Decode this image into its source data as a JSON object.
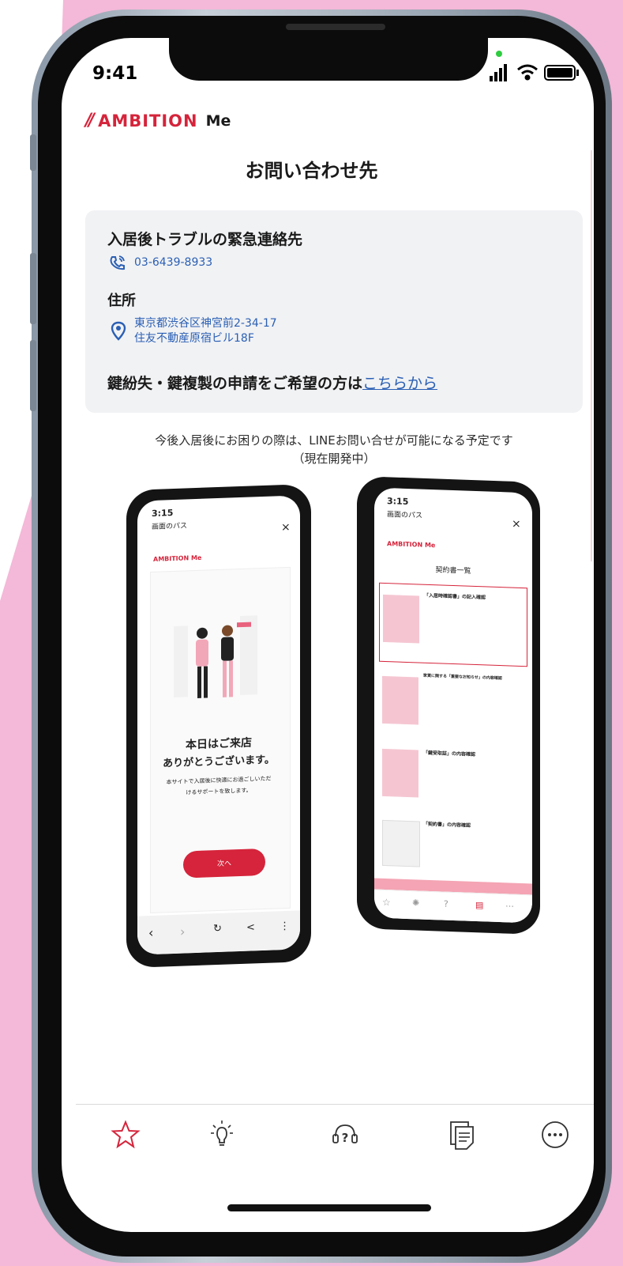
{
  "colors": {
    "accent": "#d5243b",
    "link": "#2a5fb4",
    "background_pink": "#f4b8d8",
    "card": "#f1f2f4"
  },
  "status_bar": {
    "time": "9:41",
    "icons": [
      "signal-icon",
      "wifi-icon",
      "battery-icon"
    ]
  },
  "header": {
    "logo_text": "AMBITION",
    "logo_suffix": "Me",
    "page_title": "お問い合わせ先"
  },
  "contact_card": {
    "emergency_heading": "入居後トラブルの緊急連絡先",
    "phone_number": "03-6439-8933",
    "address_heading": "住所",
    "address_line1": "東京都渋谷区神宮前2-34-17",
    "address_line2": "住友不動産原宿ビル18F",
    "key_request_text": "鍵紛失・鍵複製の申請をご希望の方は",
    "key_request_link": "こちらから"
  },
  "notice": {
    "line1": "今後入居後にお困りの際は、LINEお問い合せが可能になる予定です",
    "line2": "（現在開発中）"
  },
  "mockup_left": {
    "time": "3:15",
    "browser_title": "画面のパス",
    "logo": "AMBITION Me",
    "welcome_line1": "本日はご来店",
    "welcome_line2": "ありがとうございます。",
    "body_line1": "本サイトで入居後に快適にお過ごしいただ",
    "body_line2": "けるサポートを致します。",
    "next_button": "次へ"
  },
  "mockup_right": {
    "time": "3:15",
    "browser_title": "画面のパス",
    "logo": "AMBITION Me",
    "list_title": "契約書一覧",
    "items": [
      {
        "title": "「入居時確認書」の記入確認"
      },
      {
        "title": "家賃に関する「重要なお知らせ」の内容確認"
      },
      {
        "title": "「鍵受取証」の内容確認"
      },
      {
        "title": "「契約書」の内容確認"
      }
    ]
  },
  "bottom_nav": {
    "items": [
      {
        "icon": "star-icon",
        "active": true
      },
      {
        "icon": "lightbulb-icon",
        "active": false
      },
      {
        "icon": "support-icon",
        "active": false
      },
      {
        "icon": "document-icon",
        "active": false
      },
      {
        "icon": "more-icon",
        "active": false
      }
    ]
  }
}
